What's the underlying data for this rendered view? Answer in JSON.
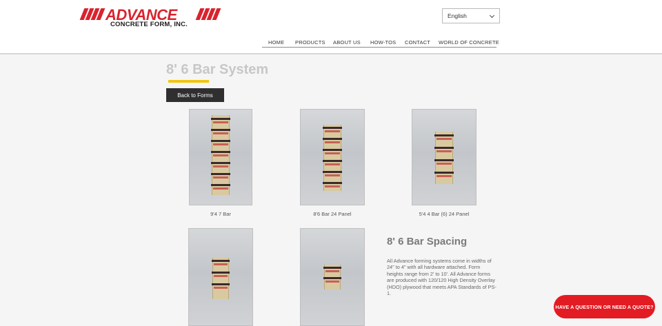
{
  "header": {
    "logo": {
      "wordmark": "ADVANCE",
      "tagline": "CONCRETE FORM, INC.",
      "color": "#d9232e"
    },
    "language": {
      "selected": "English",
      "icon": "chevron-down-icon"
    },
    "nav": [
      {
        "label": "HOME"
      },
      {
        "label": "PRODUCTS"
      },
      {
        "label": "ABOUT US"
      },
      {
        "label": "HOW-TOS"
      },
      {
        "label": "CONTACT"
      },
      {
        "label": "WORLD OF CONCRETE"
      }
    ]
  },
  "main": {
    "title": "8' 6 Bar System",
    "accent_color": "#f2c511",
    "back_label": "Back to Forms",
    "gallery": [
      {
        "caption": "9'4 7 Bar"
      },
      {
        "caption": "8'6 Bar 24 Panel"
      },
      {
        "caption": "5'4 4 Bar (6) 24 Panel"
      },
      {
        "caption": ""
      },
      {
        "caption": ""
      }
    ],
    "spacing": {
      "title": "8' 6 Bar Spacing",
      "text": "All Advance forming systems come in widths of 24\" to 4\" with all hardware attached.  Form heights range from 2' to 10'.  All Advance forms are produced with 120/120 High Density Overlay (HDO) plywood that meets APA Standards of PS-1."
    }
  },
  "chat": {
    "label": "HAVE A QUESTION OR NEED A QUOTE?",
    "color": "#e31b23"
  }
}
